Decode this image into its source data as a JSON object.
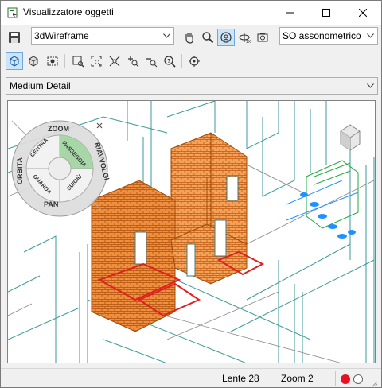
{
  "window": {
    "title": "Visualizzatore oggetti"
  },
  "toolbar1": {
    "visual_style": "3dWireframe",
    "view_preset": "SO assonometrico",
    "icons": [
      "save-icon",
      "pan-hand-icon",
      "zoom-icon",
      "orbit-icon",
      "orbit-extended-icon",
      "camera-icon"
    ]
  },
  "toolbar2": {
    "icons": [
      "view-cube-icon",
      "box-solid-icon",
      "capture-icon",
      "zoom-window-icon",
      "zoom-extents-icon",
      "zoom-all-icon",
      "zoom-in-icon",
      "zoom-out-icon",
      "zoom-prev-icon",
      "target-icon"
    ]
  },
  "detail": {
    "value": "Medium Detail"
  },
  "steering_wheel": {
    "zoom": "ZOOM",
    "orbita": "ORBITA",
    "riavvolgi": "RIAVVOLGI",
    "pan": "PAN",
    "centra": "CENTRA",
    "passeggia": "PASSEGGIA",
    "guarda": "GUARDA",
    "su_giu": "SU/GIÙ"
  },
  "status": {
    "lens": "Lente 28",
    "zoom": "Zoom 2"
  },
  "colors": {
    "brick": "#e07a1f",
    "wire": "#2a8a8a",
    "red_highlight": "#e02020",
    "blue_fixture": "#1e90ff",
    "green": "#22aa44",
    "status_red": "#e81123"
  }
}
